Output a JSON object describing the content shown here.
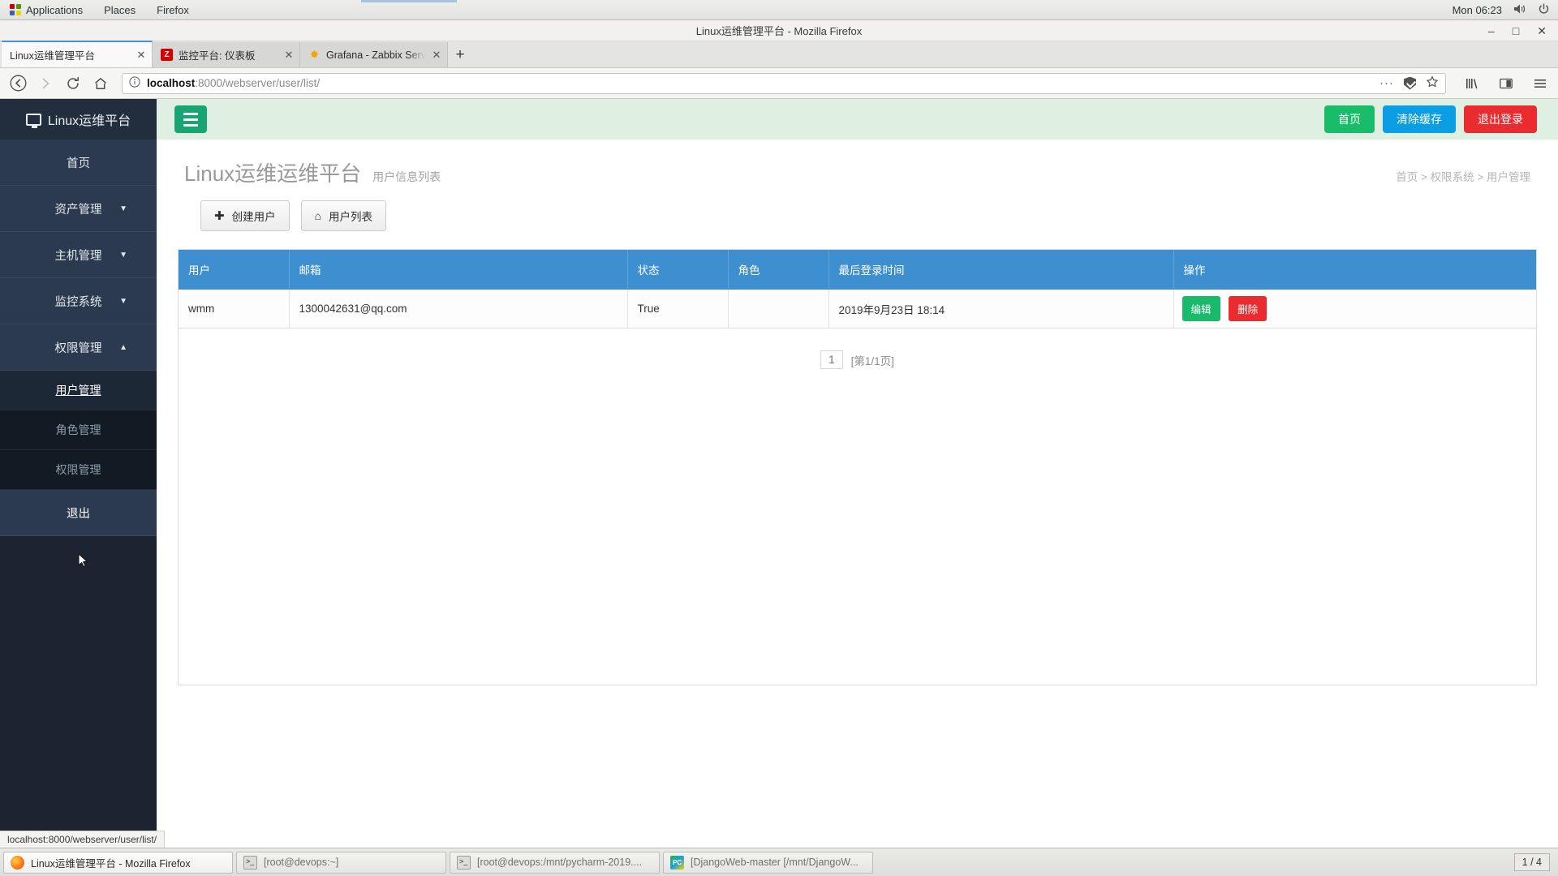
{
  "desktop": {
    "menus": [
      "Applications",
      "Places",
      "Firefox"
    ],
    "clock": "Mon 06:23",
    "volume_icon": "volume-icon",
    "power_icon": "power-icon"
  },
  "window": {
    "title": "Linux运维管理平台 - Mozilla Firefox",
    "minimize": "–",
    "maximize": "□",
    "close": "✕"
  },
  "browser": {
    "tabs": [
      {
        "title": "Linux运维管理平台",
        "favicon": "none",
        "active": true,
        "close": "✕"
      },
      {
        "title": "监控平台: 仪表板",
        "favicon": "zabbix-icon",
        "favicon_text": "Z",
        "active": false,
        "close": "✕"
      },
      {
        "title": "Grafana - Zabbix Server D",
        "favicon": "grafana-icon",
        "favicon_text": "✸",
        "active": false,
        "close": "✕"
      }
    ],
    "new_tab_label": "+",
    "url_host": "localhost",
    "url_path": ":8000/webserver/user/list/",
    "url_full": "localhost:8000/webserver/user/list/",
    "nav": {
      "back": "back-icon",
      "forward": "forward-icon",
      "reload": "reload-icon",
      "home": "home-icon",
      "page_info": "info-icon",
      "page_actions": "···",
      "pocket": "pocket-icon",
      "bookmark": "star-icon",
      "library": "library-icon",
      "sidebar": "sidebar-icon",
      "menu": "hamburger-icon"
    },
    "status_text": "localhost:8000/webserver/user/list/"
  },
  "sidebar": {
    "brand": "Linux运维平台",
    "brand_icon": "monitor-icon",
    "items": [
      {
        "label": "首页",
        "type": "link",
        "caret": ""
      },
      {
        "label": "资产管理",
        "type": "group",
        "caret": "▼"
      },
      {
        "label": "主机管理",
        "type": "group",
        "caret": "▼"
      },
      {
        "label": "监控系统",
        "type": "group",
        "caret": "▼"
      },
      {
        "label": "权限管理",
        "type": "group",
        "caret": "▲"
      }
    ],
    "sub_items": [
      {
        "label": "用户管理",
        "active": true
      },
      {
        "label": "角色管理",
        "active": false
      },
      {
        "label": "权限管理",
        "active": false
      }
    ],
    "logout": "退出"
  },
  "topbar": {
    "toggle_icon": "hamburger-icon",
    "home_button": "首页",
    "clear_cache_button": "清除缓存",
    "logout_button": "退出登录",
    "colors": {
      "green": "#18bc69",
      "blue": "#0c9ee5",
      "red": "#ea2c30",
      "burger_green": "#17a673",
      "bar_bg": "#dff0e3"
    }
  },
  "page": {
    "title": "Linux运维运维平台",
    "subtitle": "用户信息列表",
    "breadcrumb": "首页 > 权限系统 > 用户管理",
    "actions": [
      {
        "label": "创建用户",
        "icon": "plus-icon",
        "glyph": "✚"
      },
      {
        "label": "用户列表",
        "icon": "home-icon",
        "glyph": "⌂"
      }
    ]
  },
  "table": {
    "headers": [
      "用户",
      "邮箱",
      "状态",
      "角色",
      "最后登录时间",
      "操作"
    ],
    "header_bg": "#3e8fd0",
    "rows": [
      {
        "user": "wmm",
        "email": "1300042631@qq.com",
        "status": "True",
        "role": "",
        "last_login": "2019年9月23日 18:14",
        "edit_label": "编辑",
        "delete_label": "删除"
      }
    ]
  },
  "pagination": {
    "current_page": "1",
    "info": "[第1/1页]"
  },
  "taskbar": {
    "items": [
      {
        "label": "Linux运维管理平台 - Mozilla Firefox",
        "icon": "firefox-icon",
        "active": true
      },
      {
        "label": "[root@devops:~]",
        "icon": "terminal-icon",
        "active": false
      },
      {
        "label": "[root@devops:/mnt/pycharm-2019....",
        "icon": "terminal-icon",
        "active": false
      },
      {
        "label": "[DjangoWeb-master [/mnt/DjangoW...",
        "icon": "pycharm-icon",
        "active": false
      }
    ],
    "workspace": "1 / 4"
  }
}
